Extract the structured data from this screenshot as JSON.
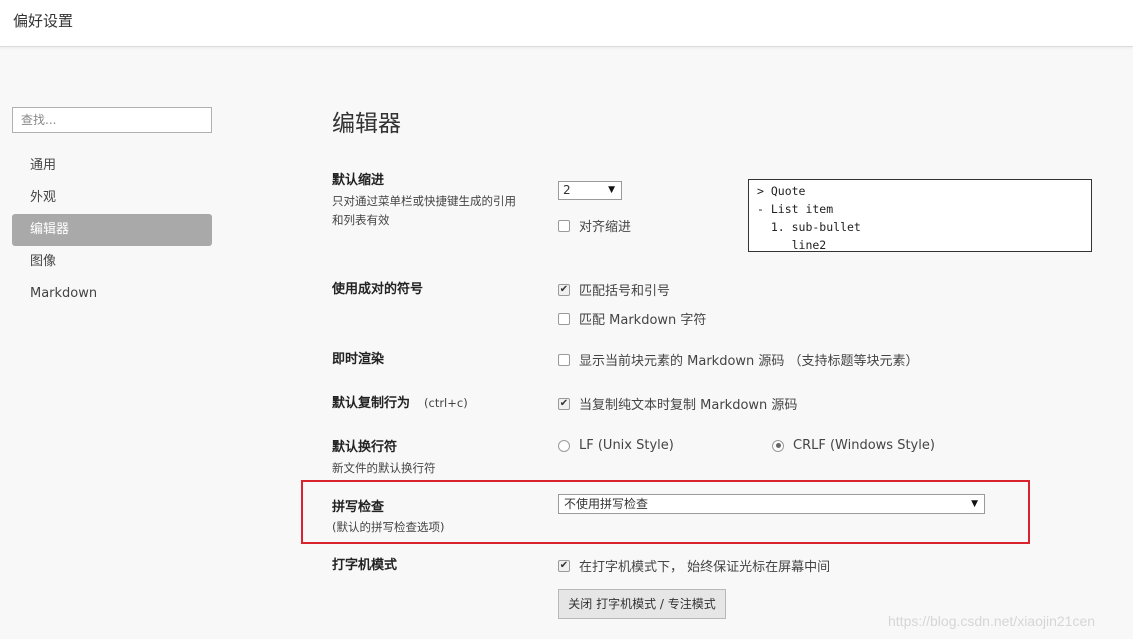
{
  "window": {
    "title": "偏好设置"
  },
  "search": {
    "placeholder": "查找..."
  },
  "sidebar": {
    "items": [
      {
        "label": "通用"
      },
      {
        "label": "外观"
      },
      {
        "label": "编辑器"
      },
      {
        "label": "图像"
      },
      {
        "label": "Markdown"
      }
    ],
    "active_index": 2
  },
  "main": {
    "title": "编辑器",
    "indent": {
      "label": "默认缩进",
      "desc_line1": "只对通过菜单栏或快捷键生成的引用",
      "desc_line2": "和列表有效",
      "select_value": "2",
      "align_label": "对齐缩进",
      "align_checked": false,
      "preview": "> Quote\n- List item\n  1. sub-bullet\n     line2"
    },
    "pairs": {
      "label": "使用成对的符号",
      "opt1_label": "匹配括号和引号",
      "opt1_checked": true,
      "opt2_label": "匹配 Markdown 字符",
      "opt2_checked": false
    },
    "render": {
      "label": "即时渲染",
      "opt_label": "显示当前块元素的 Markdown 源码 （支持标题等块元素）",
      "opt_checked": false
    },
    "copy": {
      "label": "默认复制行为",
      "shortcut": "(ctrl+c)",
      "opt_label": "当复制纯文本时复制 Markdown 源码",
      "opt_checked": true
    },
    "linebreak": {
      "label": "默认换行符",
      "desc": "新文件的默认换行符",
      "opt1_label": "LF (Unix Style)",
      "opt2_label": "CRLF (Windows Style)",
      "selected": "CRLF (Windows Style)"
    },
    "spell": {
      "label": "拼写检查",
      "desc": "(默认的拼写检查选项)",
      "select_value": "不使用拼写检查"
    },
    "typewriter": {
      "label": "打字机模式",
      "opt_label": "在打字机模式下， 始终保证光标在屏幕中间",
      "opt_checked": true,
      "button_label": "关闭 打字机模式 / 专注模式"
    }
  },
  "watermark": "https://blog.csdn.net/xiaojin21cen",
  "colors": {
    "highlight": "#d9232f",
    "active_nav": "#a9a9a9"
  }
}
